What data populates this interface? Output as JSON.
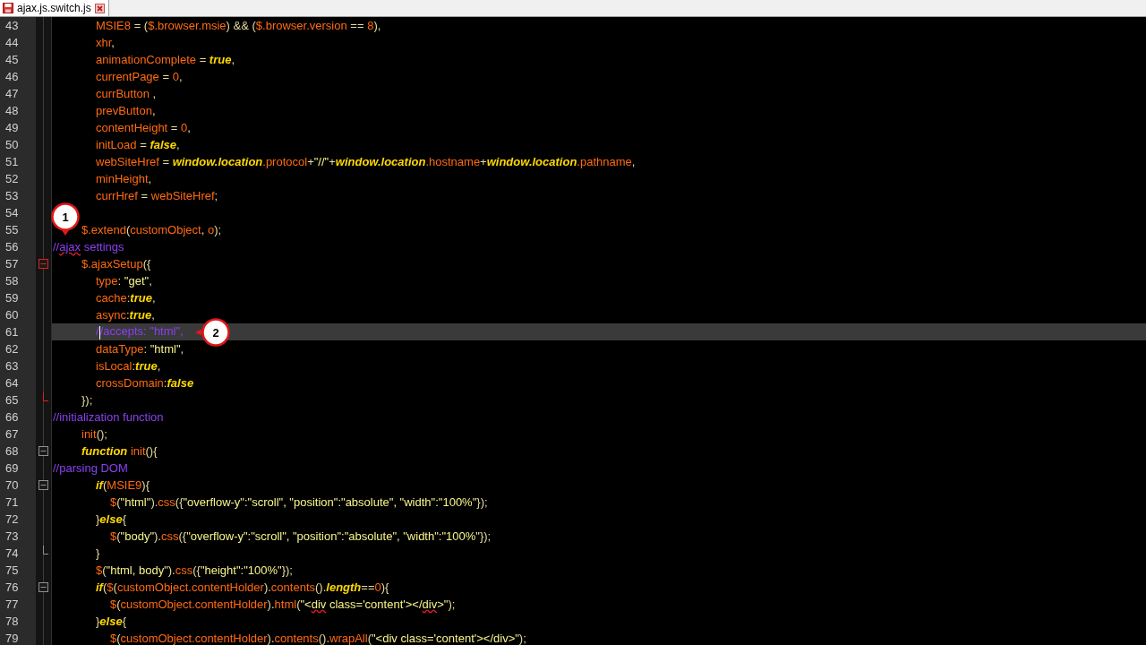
{
  "tab": {
    "title": "ajax.js.switch.js",
    "selected": true
  },
  "lines": [
    {
      "number": "43",
      "kind": "member",
      "tokens": [
        {
          "t": "MSIE8",
          "kind": "id"
        },
        {
          "t": " = (",
          "kind": "op"
        },
        {
          "t": "$.browser.msie",
          "kind": "id"
        },
        {
          "t": ") && (",
          "kind": "op"
        },
        {
          "t": "$.browser.version",
          "kind": "id"
        },
        {
          "t": " == ",
          "kind": "op"
        },
        {
          "t": "8",
          "kind": "num"
        },
        {
          "t": "),",
          "kind": "op"
        }
      ]
    },
    {
      "number": "44",
      "kind": "member",
      "tokens": [
        {
          "t": "xhr",
          "kind": "id"
        },
        {
          "t": ",",
          "kind": "op"
        }
      ]
    },
    {
      "number": "45",
      "kind": "member",
      "tokens": [
        {
          "t": "animationComplete",
          "kind": "id"
        },
        {
          "t": " = ",
          "kind": "op"
        },
        {
          "t": "true",
          "kind": "kw"
        },
        {
          "t": ",",
          "kind": "op"
        }
      ]
    },
    {
      "number": "46",
      "kind": "member",
      "tokens": [
        {
          "t": "currentPage",
          "kind": "id"
        },
        {
          "t": " = ",
          "kind": "op"
        },
        {
          "t": "0",
          "kind": "num"
        },
        {
          "t": ",",
          "kind": "op"
        }
      ]
    },
    {
      "number": "47",
      "kind": "member",
      "tokens": [
        {
          "t": "currButton",
          "kind": "id"
        },
        {
          "t": " ,",
          "kind": "op"
        }
      ]
    },
    {
      "number": "48",
      "kind": "member",
      "tokens": [
        {
          "t": "prevButton",
          "kind": "id"
        },
        {
          "t": ",",
          "kind": "op"
        }
      ]
    },
    {
      "number": "49",
      "kind": "member",
      "tokens": [
        {
          "t": "contentHeight",
          "kind": "id"
        },
        {
          "t": " = ",
          "kind": "op"
        },
        {
          "t": "0",
          "kind": "num"
        },
        {
          "t": ",",
          "kind": "op"
        }
      ]
    },
    {
      "number": "50",
      "kind": "member",
      "tokens": [
        {
          "t": "initLoad",
          "kind": "id"
        },
        {
          "t": " = ",
          "kind": "op"
        },
        {
          "t": "false",
          "kind": "kw"
        },
        {
          "t": ",",
          "kind": "op"
        }
      ]
    },
    {
      "number": "51",
      "kind": "member",
      "tokens": [
        {
          "t": "webSiteHref",
          "kind": "id"
        },
        {
          "t": " = ",
          "kind": "op"
        },
        {
          "t": "window.location",
          "kind": "kw"
        },
        {
          "t": ".protocol",
          "kind": "id"
        },
        {
          "t": "+",
          "kind": "op"
        },
        {
          "t": "\"//\"",
          "kind": "str"
        },
        {
          "t": "+",
          "kind": "op"
        },
        {
          "t": "window.location",
          "kind": "kw"
        },
        {
          "t": ".hostname",
          "kind": "id"
        },
        {
          "t": "+",
          "kind": "op"
        },
        {
          "t": "window.location",
          "kind": "kw"
        },
        {
          "t": ".pathname",
          "kind": "id"
        },
        {
          "t": ",",
          "kind": "op"
        }
      ]
    },
    {
      "number": "52",
      "kind": "member",
      "tokens": [
        {
          "t": "minHeight",
          "kind": "id"
        },
        {
          "t": ",",
          "kind": "op"
        }
      ]
    },
    {
      "number": "53",
      "kind": "member",
      "tokens": [
        {
          "t": "currHref",
          "kind": "id"
        },
        {
          "t": " = ",
          "kind": "op"
        },
        {
          "t": "webSiteHref",
          "kind": "id"
        },
        {
          "t": ";",
          "kind": "op"
        }
      ]
    },
    {
      "number": "54",
      "kind": "blank",
      "callout": {
        "label": "1",
        "kind": "down"
      }
    },
    {
      "number": "55",
      "kind": "stmt",
      "tokens": [
        {
          "t": "$.extend",
          "kind": "id"
        },
        {
          "t": "(",
          "kind": "op"
        },
        {
          "t": "customObject",
          "kind": "id"
        },
        {
          "t": ", ",
          "kind": "op"
        },
        {
          "t": "o",
          "kind": "id"
        },
        {
          "t": ");",
          "kind": "op"
        }
      ]
    },
    {
      "number": "56",
      "kind": "top",
      "tokens": [
        {
          "t": "//",
          "kind": "cmt"
        },
        {
          "t": "ajax",
          "kind": "cmt",
          "misspelled": true
        },
        {
          "t": " settings",
          "kind": "cmt"
        }
      ]
    },
    {
      "number": "57",
      "kind": "stmt",
      "fold": {
        "kind": "open",
        "active": true
      },
      "tokens": [
        {
          "t": "$.ajaxSetup",
          "kind": "id"
        },
        {
          "t": "({",
          "kind": "op"
        }
      ]
    },
    {
      "number": "58",
      "kind": "member",
      "tokens": [
        {
          "t": "type",
          "kind": "id"
        },
        {
          "t": ": ",
          "kind": "op"
        },
        {
          "t": "\"get\"",
          "kind": "str"
        },
        {
          "t": ",",
          "kind": "op"
        }
      ]
    },
    {
      "number": "59",
      "kind": "member",
      "tokens": [
        {
          "t": "cache",
          "kind": "id"
        },
        {
          "t": ":",
          "kind": "op"
        },
        {
          "t": "true",
          "kind": "kw"
        },
        {
          "t": ",",
          "kind": "op"
        }
      ]
    },
    {
      "number": "60",
      "kind": "member",
      "tokens": [
        {
          "t": "async",
          "kind": "id"
        },
        {
          "t": ":",
          "kind": "op"
        },
        {
          "t": "true",
          "kind": "kw"
        },
        {
          "t": ",",
          "kind": "op"
        }
      ]
    },
    {
      "number": "61",
      "kind": "member",
      "highlighted": true,
      "tokens": [
        {
          "t": "/",
          "kind": "cmt"
        },
        {
          "t": "/accepts: \"html\",",
          "kind": "cmt",
          "cursor": true
        }
      ],
      "callout": {
        "label": "2",
        "kind": "left"
      }
    },
    {
      "number": "62",
      "kind": "member",
      "tokens": [
        {
          "t": "dataType",
          "kind": "id"
        },
        {
          "t": ": ",
          "kind": "op"
        },
        {
          "t": "\"html\"",
          "kind": "str"
        },
        {
          "t": ",",
          "kind": "op"
        }
      ]
    },
    {
      "number": "63",
      "kind": "member",
      "tokens": [
        {
          "t": "isLocal",
          "kind": "id"
        },
        {
          "t": ":",
          "kind": "op"
        },
        {
          "t": "true",
          "kind": "kw"
        },
        {
          "t": ",",
          "kind": "op"
        }
      ]
    },
    {
      "number": "64",
      "kind": "member",
      "tokens": [
        {
          "t": "crossDomain",
          "kind": "id"
        },
        {
          "t": ":",
          "kind": "op"
        },
        {
          "t": "false",
          "kind": "kw"
        }
      ]
    },
    {
      "number": "65",
      "kind": "stmt",
      "fold": {
        "kind": "end",
        "active": true
      },
      "tokens": [
        {
          "t": "});",
          "kind": "op"
        }
      ]
    },
    {
      "number": "66",
      "kind": "top",
      "tokens": [
        {
          "t": "//initialization function",
          "kind": "cmt"
        }
      ]
    },
    {
      "number": "67",
      "kind": "stmt",
      "tokens": [
        {
          "t": "init",
          "kind": "id"
        },
        {
          "t": "();",
          "kind": "op"
        }
      ]
    },
    {
      "number": "68",
      "kind": "stmt",
      "fold": {
        "kind": "open",
        "active": false
      },
      "tokens": [
        {
          "t": "function",
          "kind": "kw"
        },
        {
          "t": " init",
          "kind": "id"
        },
        {
          "t": "(){",
          "kind": "op"
        }
      ]
    },
    {
      "number": "69",
      "kind": "top",
      "tokens": [
        {
          "t": "//parsing DOM",
          "kind": "cmt"
        }
      ]
    },
    {
      "number": "70",
      "kind": "member",
      "fold": {
        "kind": "open",
        "active": false
      },
      "tokens": [
        {
          "t": "if",
          "kind": "kw"
        },
        {
          "t": "(",
          "kind": "op"
        },
        {
          "t": "MSIE9",
          "kind": "id"
        },
        {
          "t": "){",
          "kind": "op"
        }
      ]
    },
    {
      "number": "71",
      "kind": "inner",
      "tokens": [
        {
          "t": "$",
          "kind": "id"
        },
        {
          "t": "(",
          "kind": "op"
        },
        {
          "t": "\"html\"",
          "kind": "str"
        },
        {
          "t": ").",
          "kind": "op"
        },
        {
          "t": "css",
          "kind": "id"
        },
        {
          "t": "({",
          "kind": "op"
        },
        {
          "t": "\"overflow-y\":\"scroll\", \"position\":\"absolute\", \"width\":\"100%\"",
          "kind": "str"
        },
        {
          "t": "});",
          "kind": "op"
        }
      ]
    },
    {
      "number": "72",
      "kind": "member",
      "tokens": [
        {
          "t": "}",
          "kind": "op"
        },
        {
          "t": "else",
          "kind": "kw"
        },
        {
          "t": "{",
          "kind": "op"
        }
      ]
    },
    {
      "number": "73",
      "kind": "inner",
      "tokens": [
        {
          "t": "$",
          "kind": "id"
        },
        {
          "t": "(",
          "kind": "op"
        },
        {
          "t": "\"body\"",
          "kind": "str"
        },
        {
          "t": ").",
          "kind": "op"
        },
        {
          "t": "css",
          "kind": "id"
        },
        {
          "t": "({",
          "kind": "op"
        },
        {
          "t": "\"overflow-y\":\"scroll\", \"position\":\"absolute\", \"width\":\"100%\"",
          "kind": "str"
        },
        {
          "t": "});",
          "kind": "op"
        }
      ]
    },
    {
      "number": "74",
      "kind": "member",
      "fold": {
        "kind": "end",
        "active": false
      },
      "tokens": [
        {
          "t": "}",
          "kind": "op"
        }
      ]
    },
    {
      "number": "75",
      "kind": "member",
      "tokens": [
        {
          "t": "$",
          "kind": "id"
        },
        {
          "t": "(",
          "kind": "op"
        },
        {
          "t": "\"html, body\"",
          "kind": "str"
        },
        {
          "t": ").",
          "kind": "op"
        },
        {
          "t": "css",
          "kind": "id"
        },
        {
          "t": "({",
          "kind": "op"
        },
        {
          "t": "\"height\":\"100%\"",
          "kind": "str"
        },
        {
          "t": "});",
          "kind": "op"
        }
      ]
    },
    {
      "number": "76",
      "kind": "member",
      "fold": {
        "kind": "open",
        "active": false
      },
      "tokens": [
        {
          "t": "if",
          "kind": "kw"
        },
        {
          "t": "(",
          "kind": "op"
        },
        {
          "t": "$",
          "kind": "id"
        },
        {
          "t": "(",
          "kind": "op"
        },
        {
          "t": "customObject.contentHolder",
          "kind": "id"
        },
        {
          "t": ").",
          "kind": "op"
        },
        {
          "t": "contents",
          "kind": "id"
        },
        {
          "t": "().",
          "kind": "op"
        },
        {
          "t": "length",
          "kind": "kw"
        },
        {
          "t": "==",
          "kind": "op"
        },
        {
          "t": "0",
          "kind": "num"
        },
        {
          "t": "){",
          "kind": "op"
        }
      ]
    },
    {
      "number": "77",
      "kind": "inner",
      "tokens": [
        {
          "t": "$",
          "kind": "id"
        },
        {
          "t": "(",
          "kind": "op"
        },
        {
          "t": "customObject.contentHolder",
          "kind": "id"
        },
        {
          "t": ").",
          "kind": "op"
        },
        {
          "t": "html",
          "kind": "id"
        },
        {
          "t": "(",
          "kind": "op"
        },
        {
          "t": "\"<",
          "kind": "str"
        },
        {
          "t": "div",
          "kind": "str",
          "misspelled": true
        },
        {
          "t": " class='content'></",
          "kind": "str"
        },
        {
          "t": "div",
          "kind": "str",
          "misspelled": true
        },
        {
          "t": ">\"",
          "kind": "str"
        },
        {
          "t": ");",
          "kind": "op"
        }
      ]
    },
    {
      "number": "78",
      "kind": "member",
      "tokens": [
        {
          "t": "}",
          "kind": "op"
        },
        {
          "t": "else",
          "kind": "kw"
        },
        {
          "t": "{",
          "kind": "op"
        }
      ]
    },
    {
      "number": "79",
      "kind": "inner",
      "tokens": [
        {
          "t": "$",
          "kind": "id"
        },
        {
          "t": "(",
          "kind": "op"
        },
        {
          "t": "customObject.contentHolder",
          "kind": "id"
        },
        {
          "t": ").",
          "kind": "op"
        },
        {
          "t": "contents",
          "kind": "id"
        },
        {
          "t": "().",
          "kind": "op"
        },
        {
          "t": "wrapAll",
          "kind": "id"
        },
        {
          "t": "(",
          "kind": "op"
        },
        {
          "t": "\"<div class='content'></div>\"",
          "kind": "str"
        },
        {
          "t": ");",
          "kind": "op"
        }
      ]
    }
  ]
}
